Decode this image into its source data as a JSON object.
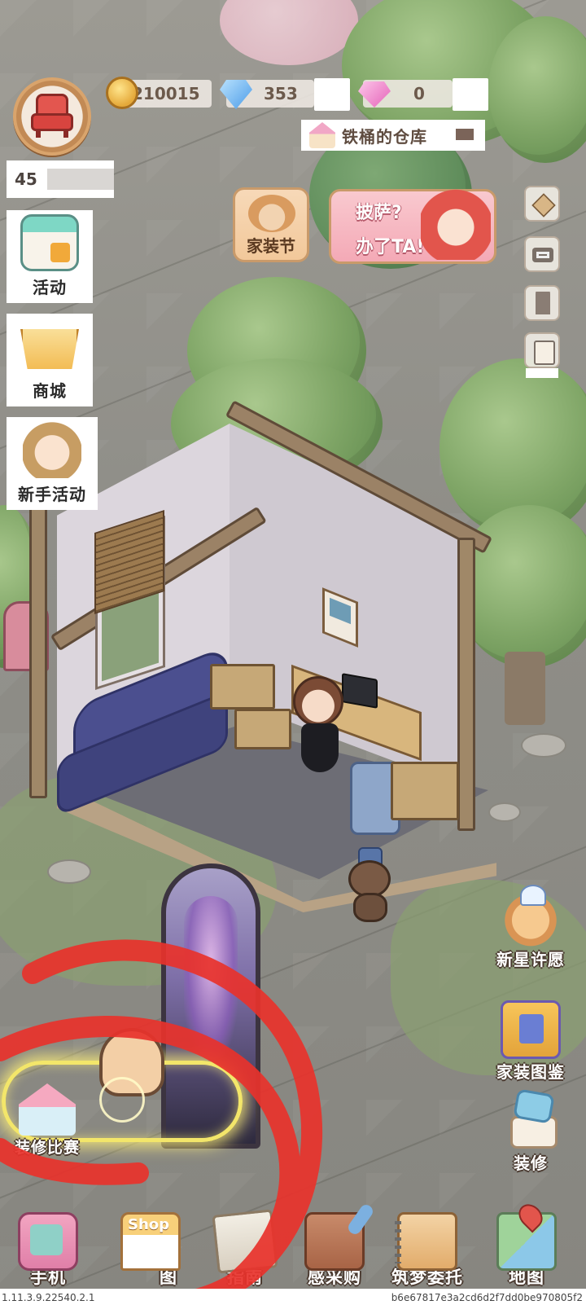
{
  "hud": {
    "coins": "210015",
    "diamonds": "353",
    "pink_gems": "0",
    "warehouse_label": "铁桶的仓库",
    "level": "45"
  },
  "left_menu": [
    {
      "label": "活动",
      "icon": "calendar-icon"
    },
    {
      "label": "商城",
      "icon": "vip-cart-icon"
    },
    {
      "label": "新手活动",
      "icon": "newbie-avatar-icon"
    }
  ],
  "banners": {
    "home_festival": "家装节",
    "pizza_line1": "披萨?",
    "pizza_line2": "办了TA!"
  },
  "right_menu": [
    {
      "label": "新星许愿",
      "icon": "wish-dog-icon"
    },
    {
      "label": "家装图鉴",
      "icon": "catalog-book-icon"
    },
    {
      "label": "装修",
      "icon": "renovate-icon"
    }
  ],
  "contest": {
    "label": "装修比赛",
    "icon": "contest-house-icon"
  },
  "bottom_nav": [
    {
      "label": "手机",
      "icon": "phone-icon"
    },
    {
      "label": "图",
      "icon": "shop-icon",
      "sign": "Shop"
    },
    {
      "label": "指南",
      "icon": "guide-icon"
    },
    {
      "label": "感采购",
      "icon": "purchase-icon"
    },
    {
      "label": "筑梦委托",
      "icon": "dream-commission-icon"
    },
    {
      "label": "地图",
      "icon": "map-icon"
    }
  ],
  "footer": {
    "version": "1.11.3.9.22540.2.1",
    "hash": "b6e67817e3a2cd6d2f7dd0be970805f2"
  },
  "colors": {
    "annotation_red": "#e8322b",
    "highlight_yellow": "#f3e66a",
    "label_outline": "#4a3a30"
  }
}
